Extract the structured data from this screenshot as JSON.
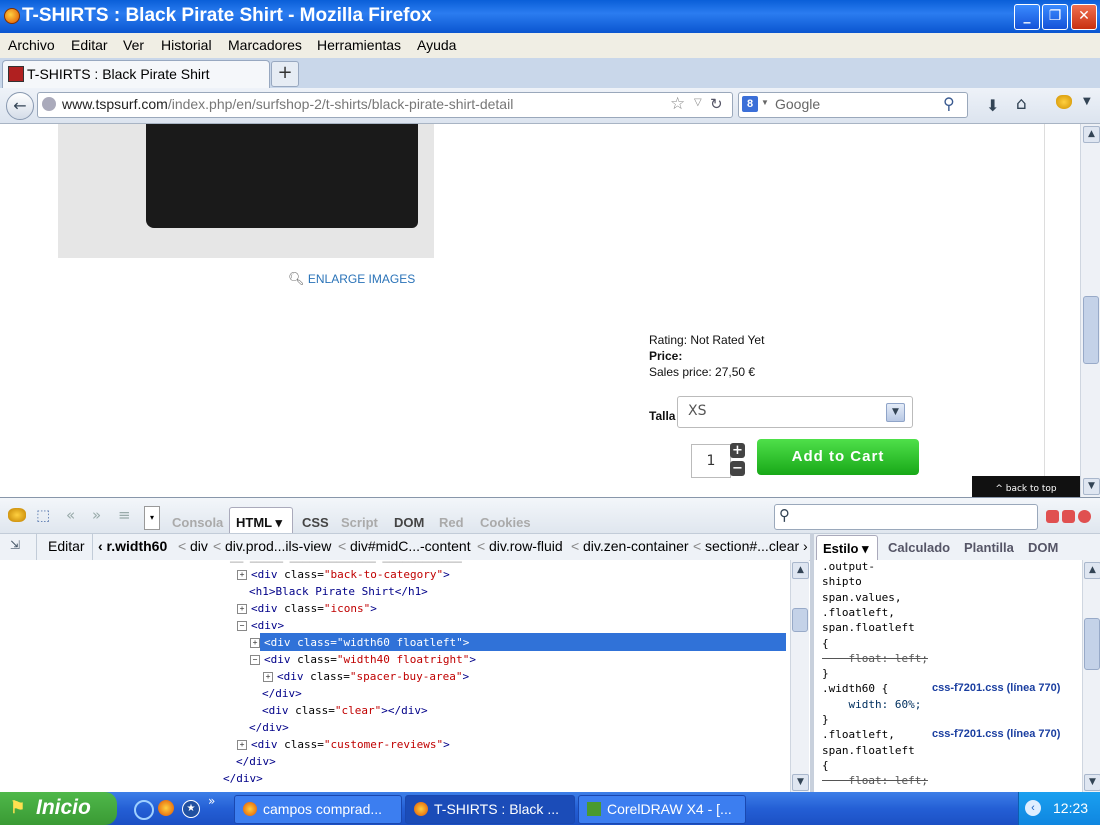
{
  "window": {
    "title": "T-SHIRTS : Black Pirate Shirt - Mozilla Firefox",
    "buttons": [
      "_",
      "❐",
      "✕"
    ]
  },
  "menu": [
    "Archivo",
    "Editar",
    "Ver",
    "Historial",
    "Marcadores",
    "Herramientas",
    "Ayuda"
  ],
  "tab": {
    "title": "T-SHIRTS : Black Pirate Shirt",
    "new_tab": "+"
  },
  "nav": {
    "url_host": "www.tspsurf.com",
    "url_path": "/index.php/en/surfshop-2/t-shirts/black-pirate-shirt-detail",
    "search_placeholder": "Google"
  },
  "page": {
    "enlarge": "ENLARGE IMAGES",
    "rating": "Rating: Not Rated Yet",
    "price_label": "Price:",
    "sales_price": "Sales price: 27,50 €",
    "talla_label": "Talla",
    "talla_value": "XS",
    "quantity": "1",
    "add_to_cart": "Add to Cart",
    "back_to_top": "^ back to top"
  },
  "firebug": {
    "tabs": [
      "Consola",
      "HTML ▾",
      "CSS",
      "Script",
      "DOM",
      "Red",
      "Cookies"
    ],
    "edit": "Editar",
    "breadcrumbs": [
      "‹ r.width60",
      "div",
      "div.prod...ils-view",
      "div#midC...-content",
      "div.row-fluid",
      "div.zen-container",
      "section#...clear ›"
    ],
    "side_tabs": [
      "Estilo ▾",
      "Calculado",
      "Plantilla",
      "DOM"
    ],
    "html_lines": [
      {
        "indent": 1,
        "toggle": "+",
        "tag": "div",
        "attr": "class",
        "val": "back-to-category",
        "close": false
      },
      {
        "indent": 1,
        "toggle": "",
        "raw": "<h1>Black Pirate Shirt</h1>"
      },
      {
        "indent": 1,
        "toggle": "+",
        "tag": "div",
        "attr": "class",
        "val": "icons",
        "close": false
      },
      {
        "indent": 1,
        "toggle": "-",
        "raw": "<div>"
      },
      {
        "indent": 2,
        "toggle": "+",
        "tag": "div",
        "attr": "class",
        "val": "width60 floatleft",
        "selected": true
      },
      {
        "indent": 2,
        "toggle": "-",
        "tag": "div",
        "attr": "class",
        "val": "width40 floatright"
      },
      {
        "indent": 3,
        "toggle": "+",
        "tag": "div",
        "attr": "class",
        "val": "spacer-buy-area"
      },
      {
        "indent": 2,
        "toggle": "",
        "raw": "</div>"
      },
      {
        "indent": 2,
        "toggle": "",
        "tag": "div",
        "attr": "class",
        "val": "clear",
        "selfclose": true
      },
      {
        "indent": 1,
        "toggle": "",
        "raw": "</div>"
      },
      {
        "indent": 1,
        "toggle": "+",
        "tag": "div",
        "attr": "class",
        "val": "customer-reviews"
      },
      {
        "indent": 0,
        "toggle": "",
        "raw": "</div>"
      },
      {
        "indent": -1,
        "toggle": "",
        "raw": "</div>"
      }
    ],
    "css_lines": [
      ".output-",
      "shipto",
      "span.values,",
      ".floatleft,",
      "span.floatleft",
      "{",
      "    float: left;",
      "}",
      ".width60 {",
      "    width: 60%;",
      "}",
      ".floatleft,",
      "span.floatleft",
      "{",
      "    float: left;"
    ],
    "css_source_1": "css-f7201.css (línea 770)",
    "css_source_2": "css-f7201.css (línea 770)"
  },
  "taskbar": {
    "start": "Inicio",
    "tasks": [
      "campos comprad...",
      "T-SHIRTS : Black ...",
      "CorelDRAW X4 - [..."
    ],
    "clock": "12:23"
  }
}
